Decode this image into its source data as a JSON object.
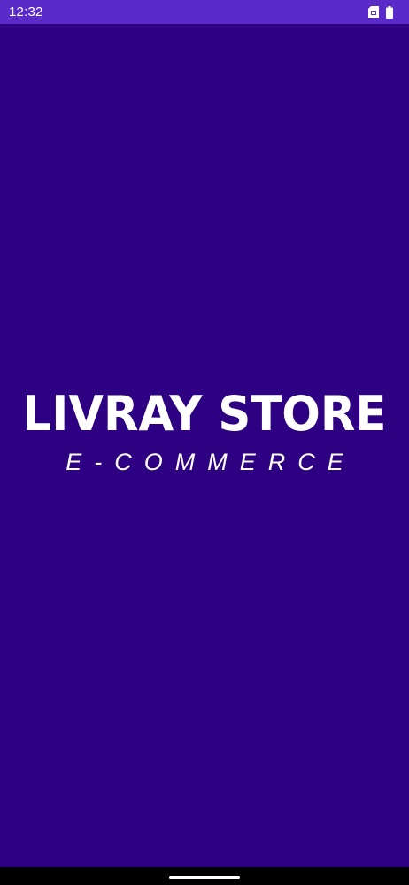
{
  "status_bar": {
    "time": "12:32",
    "icons": [
      "sim-card-icon",
      "battery-icon"
    ]
  },
  "splash": {
    "title": "LIVRAY STORE",
    "subtitle": "E-COMMERCE"
  },
  "colors": {
    "background": "#2E0082",
    "status_bar": "#5A2BC8",
    "text": "#FFFFFF",
    "nav_bar": "#000000"
  }
}
